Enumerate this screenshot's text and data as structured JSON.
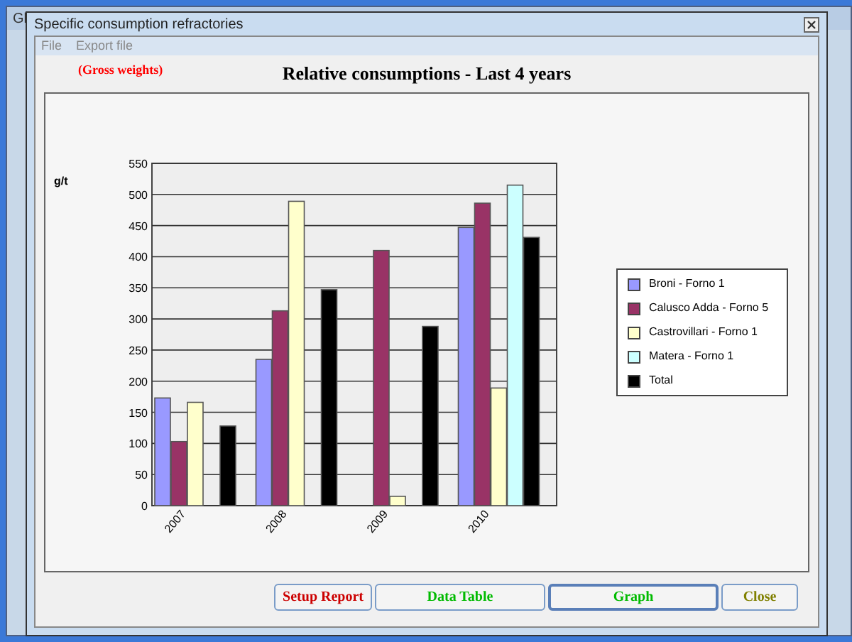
{
  "background_window": {
    "title": "Gl"
  },
  "window": {
    "title": "Specific consumption refractories"
  },
  "menu": [
    "File",
    "Export file"
  ],
  "note": "(Gross weights)",
  "heading": "Relative consumptions - Last 4 years",
  "chart": {
    "chart_data": {
      "type": "bar",
      "annotations": [
        {
          "text": "g/t"
        }
      ],
      "grid": true,
      "categories": [
        "2007",
        "2008",
        "2009",
        "2010"
      ],
      "ylim": [
        0,
        550
      ],
      "yticks": [
        0,
        50,
        100,
        150,
        200,
        250,
        300,
        350,
        400,
        450,
        500,
        550
      ],
      "series": [
        {
          "name": "Broni - Forno 1",
          "color": "#9999ff",
          "values": [
            173,
            235,
            null,
            447
          ]
        },
        {
          "name": "Calusco Adda - Forno 5",
          "color": "#993366",
          "values": [
            103,
            313,
            410,
            486
          ]
        },
        {
          "name": "Castrovillari - Forno 1",
          "color": "#ffffcc",
          "values": [
            166,
            489,
            15,
            189
          ]
        },
        {
          "name": "Matera - Forno 1",
          "color": "#ccffff",
          "values": [
            null,
            null,
            null,
            515
          ]
        },
        {
          "name": "Total",
          "color": "#000000",
          "values": [
            128,
            347,
            288,
            431
          ]
        }
      ]
    }
  },
  "buttons": [
    {
      "label": "Setup Report",
      "color": "#cc0000",
      "selected": false
    },
    {
      "label": "Data Table",
      "color": "#00bb00",
      "selected": false
    },
    {
      "label": "Graph",
      "color": "#00bb00",
      "selected": true
    },
    {
      "label": "Close",
      "color": "#808000",
      "selected": false
    }
  ]
}
